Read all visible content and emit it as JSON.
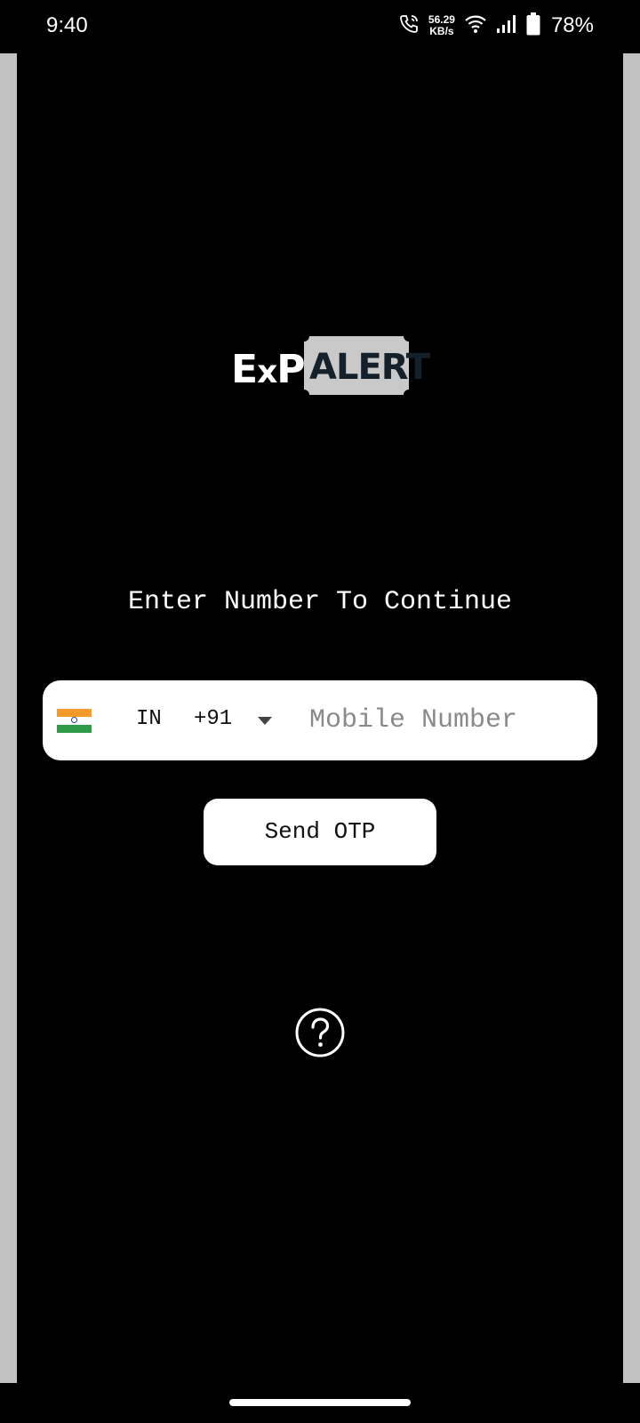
{
  "status_bar": {
    "time": "9:40",
    "net_speed_value": "56.29",
    "net_speed_unit": "KB/s",
    "battery_percent": "78%"
  },
  "logo": {
    "text": "EXPALERT"
  },
  "login": {
    "prompt": "Enter Number To Continue",
    "country_code": "IN",
    "dial_code": "+91",
    "mobile_placeholder": "Mobile Number",
    "mobile_value": "",
    "send_otp_label": "Send OTP"
  },
  "icons": {
    "flag": "india-flag-icon",
    "dropdown": "chevron-down-icon",
    "help": "help-circle-icon"
  },
  "colors": {
    "background": "#000000",
    "side_bars": "#c2c2c2",
    "badge": "#c9c9c9",
    "logo_dark": "#14202a",
    "placeholder": "#8a8a8a"
  }
}
